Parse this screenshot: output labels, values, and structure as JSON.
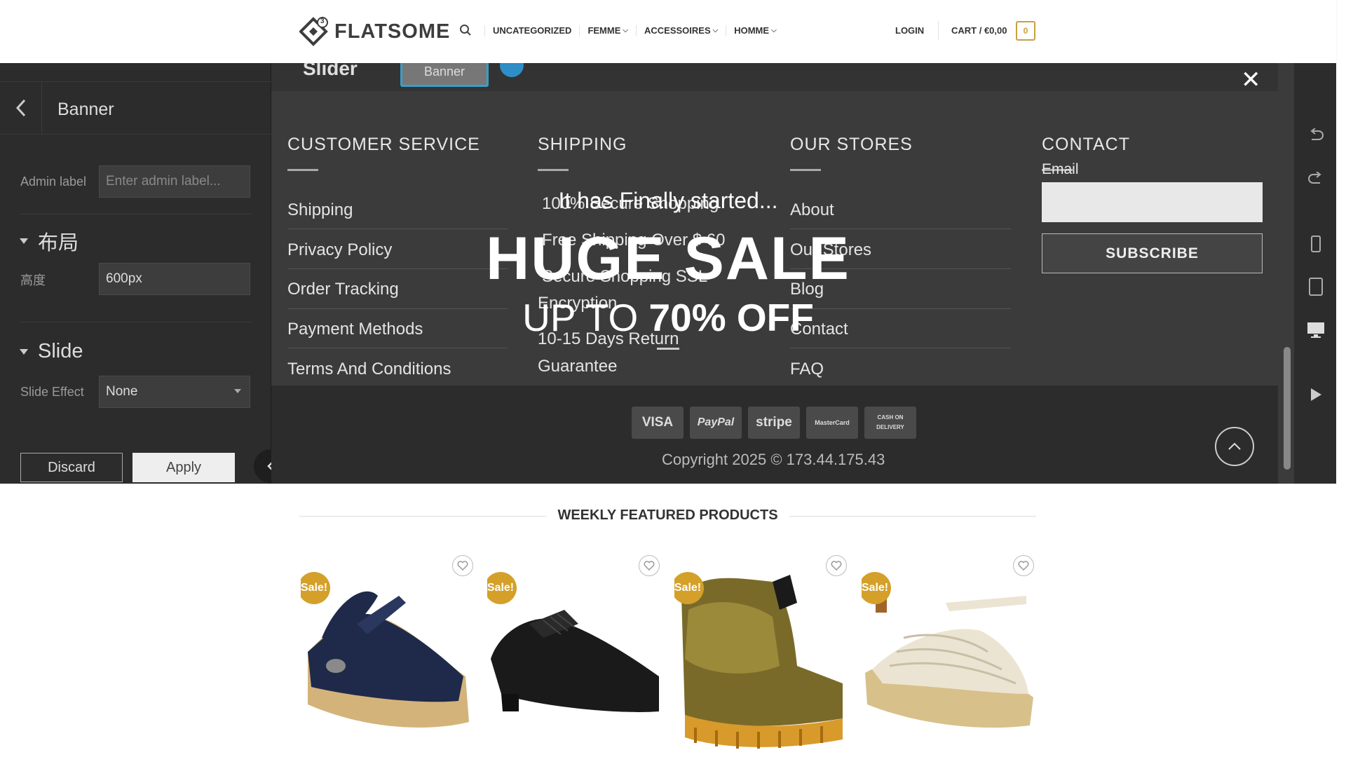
{
  "header": {
    "logo_text": "FLATSOME",
    "logo_badge": "3",
    "nav": [
      {
        "label": "UNCATEGORIZED",
        "dropdown": false
      },
      {
        "label": "FEMME",
        "dropdown": true
      },
      {
        "label": "ACCESSOIRES",
        "dropdown": true
      },
      {
        "label": "HOMME",
        "dropdown": true
      }
    ],
    "login": "LOGIN",
    "cart_label": "CART / €0,00",
    "cart_count": "0"
  },
  "editor": {
    "panel_title": "Banner",
    "admin_label": "Admin label",
    "admin_placeholder": "Enter admin label...",
    "layout_section": "布局",
    "height_label": "高度",
    "height_value": "600px",
    "slide_section": "Slide",
    "slide_effect_label": "Slide Effect",
    "slide_effect_value": "None",
    "discard": "Discard",
    "apply": "Apply",
    "slider_label": "Slider",
    "banner_chip": "Banner"
  },
  "footer": {
    "columns": [
      {
        "title": "CUSTOMER SERVICE",
        "links": [
          "Shipping",
          "Privacy Policy",
          "Order Tracking",
          "Payment Methods",
          "Terms And Conditions"
        ]
      },
      {
        "title": "SHIPPING",
        "links": [
          "100% Secure Shopping",
          "Free Shipping Over $ 60",
          "Secure Shopping SSL",
          "Encryption",
          "10-15 Days Return",
          "Guarantee"
        ]
      },
      {
        "title": "OUR STORES",
        "links": [
          "About",
          "Our Stores",
          "Blog",
          "Contact",
          "FAQ"
        ]
      },
      {
        "title": "CONTACT"
      }
    ],
    "email_label": "Email",
    "subscribe": "SUBSCRIBE",
    "payments": [
      "VISA",
      "PayPal",
      "stripe",
      "MasterCard",
      "CASH ON DELIVERY"
    ],
    "copyright": "Copyright 2025 © 173.44.175.43"
  },
  "banner_overlay": {
    "small": "It has Finally started...",
    "big": "HUGE SALE",
    "mid_prefix": "UP TO ",
    "mid_bold": "70% OFF"
  },
  "featured": {
    "title": "WEEKLY FEATURED PRODUCTS",
    "sale_badge": "Sale!",
    "products": [
      {
        "name": "navy-espadrille-wedge",
        "sale": true
      },
      {
        "name": "black-leather-derby",
        "sale": true
      },
      {
        "name": "gold-puffer-boot",
        "sale": true
      },
      {
        "name": "cream-espadrille-sandal",
        "sale": true
      }
    ]
  },
  "colors": {
    "accent": "#c8a041",
    "sale_badge": "#d4a02a",
    "editor_panel": "#2c2c2c",
    "footer_dark": "#3b3b3b",
    "chip_blue": "#3a9ec9"
  }
}
